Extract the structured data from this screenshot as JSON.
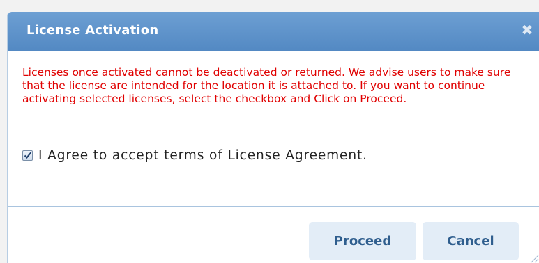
{
  "dialog": {
    "title": "License Activation",
    "close_icon": "close-icon",
    "warning_text": "Licenses once activated cannot be deactivated or returned. We advise users to make sure that the license are intended for the location it is attached to. If you want to continue activating selected licenses, select the checkbox and Click on Proceed.",
    "agree": {
      "checked": true,
      "label": "I Agree to accept terms of License Agreement."
    },
    "buttons": {
      "proceed_label": "Proceed",
      "cancel_label": "Cancel"
    }
  },
  "colors": {
    "title_bar": "#5f95cd",
    "warning_text": "#e00000",
    "button_bg": "#e3edf7",
    "button_text": "#2f5e8e"
  }
}
